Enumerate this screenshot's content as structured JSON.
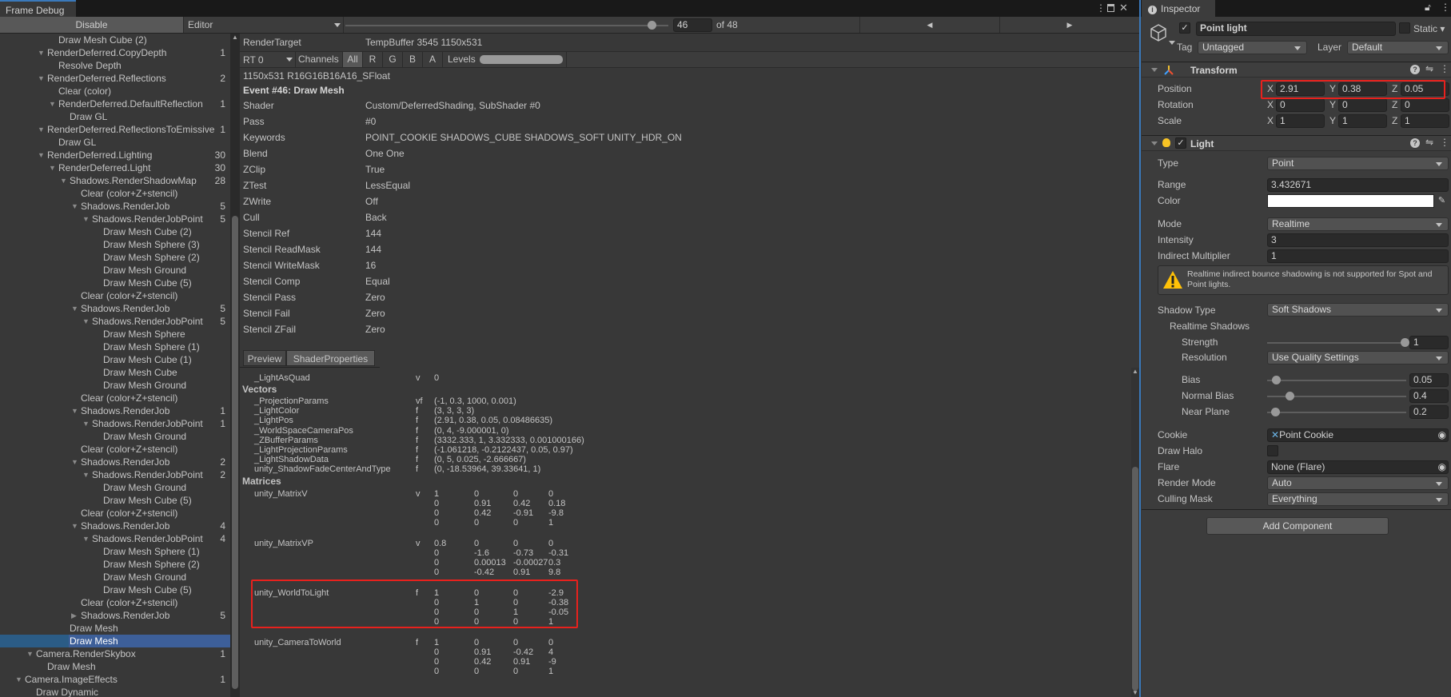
{
  "window": {
    "frame_debug_tab": "Frame Debug",
    "inspector_tab": "Inspector"
  },
  "toolbar": {
    "disable_label": "Disable",
    "target_dropdown": "Editor",
    "event_index": "46",
    "event_total": "of 48",
    "event_slider_fraction": 0.957
  },
  "tree": [
    {
      "label": "Draw Mesh Cube (2)",
      "depth": 3
    },
    {
      "label": "RenderDeferred.CopyDepth",
      "depth": 2,
      "count": "1",
      "expanded": true
    },
    {
      "label": "Resolve Depth",
      "depth": 3
    },
    {
      "label": "RenderDeferred.Reflections",
      "depth": 2,
      "count": "2",
      "expanded": true
    },
    {
      "label": "Clear (color)",
      "depth": 3
    },
    {
      "label": "RenderDeferred.DefaultReflection",
      "depth": 3,
      "count": "1",
      "expanded": true
    },
    {
      "label": "Draw GL",
      "depth": 4
    },
    {
      "label": "RenderDeferred.ReflectionsToEmissive",
      "depth": 2,
      "count": "1",
      "expanded": true
    },
    {
      "label": "Draw GL",
      "depth": 3
    },
    {
      "label": "RenderDeferred.Lighting",
      "depth": 2,
      "count": "30",
      "expanded": true
    },
    {
      "label": "RenderDeferred.Light",
      "depth": 3,
      "count": "30",
      "expanded": true
    },
    {
      "label": "Shadows.RenderShadowMap",
      "depth": 4,
      "count": "28",
      "expanded": true
    },
    {
      "label": "Clear (color+Z+stencil)",
      "depth": 5
    },
    {
      "label": "Shadows.RenderJob",
      "depth": 5,
      "count": "5",
      "expanded": true
    },
    {
      "label": "Shadows.RenderJobPoint",
      "depth": 6,
      "count": "5",
      "expanded": true
    },
    {
      "label": "Draw Mesh Cube (2)",
      "depth": 7
    },
    {
      "label": "Draw Mesh Sphere (3)",
      "depth": 7
    },
    {
      "label": "Draw Mesh Sphere (2)",
      "depth": 7
    },
    {
      "label": "Draw Mesh Ground",
      "depth": 7
    },
    {
      "label": "Draw Mesh Cube (5)",
      "depth": 7
    },
    {
      "label": "Clear (color+Z+stencil)",
      "depth": 5
    },
    {
      "label": "Shadows.RenderJob",
      "depth": 5,
      "count": "5",
      "expanded": true
    },
    {
      "label": "Shadows.RenderJobPoint",
      "depth": 6,
      "count": "5",
      "expanded": true
    },
    {
      "label": "Draw Mesh Sphere",
      "depth": 7
    },
    {
      "label": "Draw Mesh Sphere (1)",
      "depth": 7
    },
    {
      "label": "Draw Mesh Cube (1)",
      "depth": 7
    },
    {
      "label": "Draw Mesh Cube",
      "depth": 7
    },
    {
      "label": "Draw Mesh Ground",
      "depth": 7
    },
    {
      "label": "Clear (color+Z+stencil)",
      "depth": 5
    },
    {
      "label": "Shadows.RenderJob",
      "depth": 5,
      "count": "1",
      "expanded": true
    },
    {
      "label": "Shadows.RenderJobPoint",
      "depth": 6,
      "count": "1",
      "expanded": true
    },
    {
      "label": "Draw Mesh Ground",
      "depth": 7
    },
    {
      "label": "Clear (color+Z+stencil)",
      "depth": 5
    },
    {
      "label": "Shadows.RenderJob",
      "depth": 5,
      "count": "2",
      "expanded": true
    },
    {
      "label": "Shadows.RenderJobPoint",
      "depth": 6,
      "count": "2",
      "expanded": true
    },
    {
      "label": "Draw Mesh Ground",
      "depth": 7
    },
    {
      "label": "Draw Mesh Cube (5)",
      "depth": 7
    },
    {
      "label": "Clear (color+Z+stencil)",
      "depth": 5
    },
    {
      "label": "Shadows.RenderJob",
      "depth": 5,
      "count": "4",
      "expanded": true
    },
    {
      "label": "Shadows.RenderJobPoint",
      "depth": 6,
      "count": "4",
      "expanded": true
    },
    {
      "label": "Draw Mesh Sphere (1)",
      "depth": 7
    },
    {
      "label": "Draw Mesh Sphere (2)",
      "depth": 7
    },
    {
      "label": "Draw Mesh Ground",
      "depth": 7
    },
    {
      "label": "Draw Mesh Cube (5)",
      "depth": 7
    },
    {
      "label": "Clear (color+Z+stencil)",
      "depth": 5
    },
    {
      "label": "Shadows.RenderJob",
      "depth": 5,
      "count": "5",
      "expanded": false
    },
    {
      "label": "Draw Mesh",
      "depth": 4
    },
    {
      "label": "Draw Mesh",
      "depth": 4,
      "selected": true
    },
    {
      "label": "Camera.RenderSkybox",
      "depth": 1,
      "count": "1",
      "expanded": true
    },
    {
      "label": "Draw Mesh",
      "depth": 2
    },
    {
      "label": "Camera.ImageEffects",
      "depth": 0,
      "count": "1",
      "expanded": true
    },
    {
      "label": "Draw Dynamic",
      "depth": 1
    }
  ],
  "details": {
    "render_target_label": "RenderTarget",
    "render_target_value": "TempBuffer 3545 1150x531",
    "rt_dropdown": "RT 0",
    "channels_label": "Channels",
    "channels": [
      "All",
      "R",
      "G",
      "B",
      "A"
    ],
    "active_channel": "All",
    "levels_label": "Levels",
    "format": "1150x531 R16G16B16A16_SFloat",
    "event_title": "Event #46: Draw Mesh",
    "properties": [
      {
        "name": "Shader",
        "value": "Custom/DeferredShading, SubShader #0"
      },
      {
        "name": "Pass",
        "value": "#0"
      },
      {
        "name": "Keywords",
        "value": "POINT_COOKIE SHADOWS_CUBE SHADOWS_SOFT UNITY_HDR_ON"
      },
      {
        "name": "Blend",
        "value": "One One"
      },
      {
        "name": "ZClip",
        "value": "True"
      },
      {
        "name": "ZTest",
        "value": "LessEqual"
      },
      {
        "name": "ZWrite",
        "value": "Off"
      },
      {
        "name": "Cull",
        "value": "Back"
      },
      {
        "name": "Stencil Ref",
        "value": "144"
      },
      {
        "name": "Stencil ReadMask",
        "value": "144"
      },
      {
        "name": "Stencil WriteMask",
        "value": "16"
      },
      {
        "name": "Stencil Comp",
        "value": "Equal"
      },
      {
        "name": "Stencil Pass",
        "value": "Zero"
      },
      {
        "name": "Stencil Fail",
        "value": "Zero"
      },
      {
        "name": "Stencil ZFail",
        "value": "Zero"
      }
    ],
    "tabs": [
      "Preview",
      "ShaderProperties"
    ],
    "active_tab": "ShaderProperties"
  },
  "shader_properties": {
    "floats": [
      {
        "name": "_LightAsQuad",
        "type": "v",
        "value": "0"
      }
    ],
    "vectors_header": "Vectors",
    "vectors": [
      {
        "name": "_ProjectionParams",
        "type": "vf",
        "value": "(-1, 0.3, 1000, 0.001)"
      },
      {
        "name": "_LightColor",
        "type": "f",
        "value": "(3, 3, 3, 3)"
      },
      {
        "name": "_LightPos",
        "type": "f",
        "value": "(2.91, 0.38, 0.05, 0.08486635)"
      },
      {
        "name": "_WorldSpaceCameraPos",
        "type": "f",
        "value": "(0, 4, -9.000001, 0)"
      },
      {
        "name": "_ZBufferParams",
        "type": "f",
        "value": "(3332.333, 1, 3.332333, 0.001000166)"
      },
      {
        "name": "_LightProjectionParams",
        "type": "f",
        "value": "(-1.061218, -0.2122437, 0.05, 0.97)"
      },
      {
        "name": "_LightShadowData",
        "type": "f",
        "value": "(0, 5, 0.025, -2.666667)"
      },
      {
        "name": "unity_ShadowFadeCenterAndType",
        "type": "f",
        "value": "(0, -18.53964, 39.33641, 1)"
      }
    ],
    "matrices_header": "Matrices",
    "matrices": [
      {
        "name": "unity_MatrixV",
        "type": "v",
        "rows": [
          [
            "1",
            "0",
            "0",
            "0"
          ],
          [
            "0",
            "0.91",
            "0.42",
            "0.18"
          ],
          [
            "0",
            "0.42",
            "-0.91",
            "-9.8"
          ],
          [
            "0",
            "0",
            "0",
            "1"
          ]
        ]
      },
      {
        "name": "unity_MatrixVP",
        "type": "v",
        "rows": [
          [
            "0.8",
            "0",
            "0",
            "0"
          ],
          [
            "0",
            "-1.6",
            "-0.73",
            "-0.31"
          ],
          [
            "0",
            "0.00013",
            "-0.00027",
            "0.3"
          ],
          [
            "0",
            "-0.42",
            "0.91",
            "9.8"
          ]
        ]
      },
      {
        "name": "unity_WorldToLight",
        "type": "f",
        "highlighted": true,
        "rows": [
          [
            "1",
            "0",
            "0",
            "-2.9"
          ],
          [
            "0",
            "1",
            "0",
            "-0.38"
          ],
          [
            "0",
            "0",
            "1",
            "-0.05"
          ],
          [
            "0",
            "0",
            "0",
            "1"
          ]
        ]
      },
      {
        "name": "unity_CameraToWorld",
        "type": "f",
        "rows": [
          [
            "1",
            "0",
            "0",
            "0"
          ],
          [
            "0",
            "0.91",
            "-0.42",
            "4"
          ],
          [
            "0",
            "0.42",
            "0.91",
            "-9"
          ],
          [
            "0",
            "0",
            "0",
            "1"
          ]
        ]
      }
    ]
  },
  "inspector": {
    "object_name": "Point light",
    "static_label": "Static",
    "tag_label": "Tag",
    "tag_value": "Untagged",
    "layer_label": "Layer",
    "layer_value": "Default",
    "transform": {
      "title": "Transform",
      "rows": [
        {
          "label": "Position",
          "x": "2.91",
          "y": "0.38",
          "z": "0.05",
          "highlighted": true
        },
        {
          "label": "Rotation",
          "x": "0",
          "y": "0",
          "z": "0"
        },
        {
          "label": "Scale",
          "x": "1",
          "y": "1",
          "z": "1"
        }
      ],
      "axis_labels": [
        "X",
        "Y",
        "Z"
      ]
    },
    "light": {
      "title": "Light",
      "type_label": "Type",
      "type_value": "Point",
      "range_label": "Range",
      "range_value": "3.432671",
      "color_label": "Color",
      "color_value": "#ffffff",
      "mode_label": "Mode",
      "mode_value": "Realtime",
      "intensity_label": "Intensity",
      "intensity_value": "3",
      "indirect_label": "Indirect Multiplier",
      "indirect_value": "1",
      "warning": "Realtime indirect bounce shadowing is not supported for Spot and Point lights.",
      "shadow_type_label": "Shadow Type",
      "shadow_type_value": "Soft Shadows",
      "realtime_shadows_label": "Realtime Shadows",
      "strength_label": "Strength",
      "strength_value": "1",
      "strength_fraction": 1.0,
      "resolution_label": "Resolution",
      "resolution_value": "Use Quality Settings",
      "bias_label": "Bias",
      "bias_value": "0.05",
      "bias_fraction": 0.025,
      "normal_bias_label": "Normal Bias",
      "normal_bias_value": "0.4",
      "normal_bias_fraction": 0.13,
      "near_plane_label": "Near Plane",
      "near_plane_value": "0.2",
      "near_plane_fraction": 0.02,
      "cookie_label": "Cookie",
      "cookie_value": "Point Cookie",
      "draw_halo_label": "Draw Halo",
      "flare_label": "Flare",
      "flare_value": "None (Flare)",
      "render_mode_label": "Render Mode",
      "render_mode_value": "Auto",
      "culling_mask_label": "Culling Mask",
      "culling_mask_value": "Everything"
    },
    "add_component": "Add Component"
  },
  "colors": {
    "highlight_box": "#e8211d",
    "selection": "#3d5f99",
    "warning_icon": "#ffc107"
  }
}
